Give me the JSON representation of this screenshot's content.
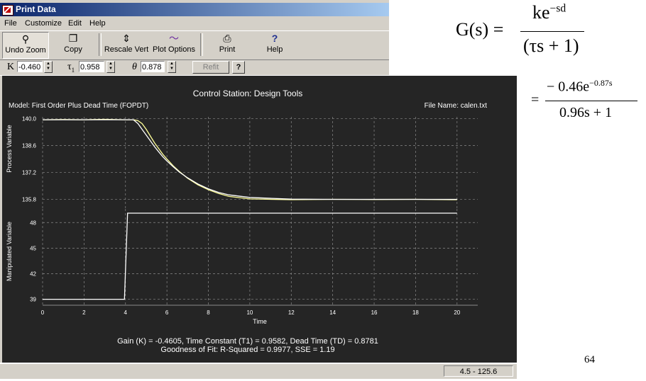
{
  "window": {
    "title": "Print Data"
  },
  "menu": [
    "File",
    "Customize",
    "Edit",
    "Help"
  ],
  "toolbar": {
    "undo_zoom": "Undo Zoom",
    "copy": "Copy",
    "rescale_vert": "Rescale Vert",
    "plot_options": "Plot Options",
    "print": "Print",
    "help": "Help"
  },
  "params": {
    "k_label": "K",
    "k_value": "-0.460",
    "tau_label": "τ",
    "tau_sub": "1",
    "tau_value": "0.958",
    "theta_label": "θ",
    "theta_value": "0.878",
    "refit_label": "Refit",
    "help_label": "?"
  },
  "plot": {
    "title": "Control Station: Design Tools",
    "model": "Model: First Order Plus Dead Time (FOPDT)",
    "file": "File Name: calen.txt",
    "pv_label": "Process Variable",
    "mv_label": "Manipulated Variable",
    "x_label": "Time",
    "fit_line1": "Gain (K) = -0.4605, Time Constant (T1) = 0.9582, Dead Time (TD) = 0.8781",
    "fit_line2": "Goodness of Fit: R-Squared = 0.9977, SSE = 1.19",
    "colors": {
      "background": "#252525",
      "grid": "#8a8a8a",
      "data": "#ffff99",
      "model": "#ffffff",
      "text": "#ffffff"
    }
  },
  "status": {
    "readout": "4.5 - 125.6"
  },
  "equations": {
    "lhs": "G(s) =",
    "num1_base": "ke",
    "num1_exp": "−sd",
    "den1": "(τs + 1)",
    "eq2": "=",
    "num2_base": "− 0.46e",
    "num2_exp": "−0.87s",
    "den2": "0.96s + 1"
  },
  "page_number": "64",
  "chart_data": [
    {
      "type": "line",
      "ylabel": "Process Variable",
      "xlabel": "",
      "xlim": [
        0,
        21
      ],
      "ylim": [
        135.3,
        140.1
      ],
      "yticks": [
        140.0,
        138.6,
        137.2,
        135.8
      ],
      "series": [
        {
          "x": [
            0,
            1,
            2,
            3,
            4,
            4.4,
            4.6,
            4.8,
            5.0,
            5.2,
            5.4,
            5.6,
            5.8,
            6.0,
            6.3,
            6.6,
            7.0,
            7.5,
            8.0,
            8.5,
            9,
            10,
            12,
            14,
            16,
            18,
            20
          ],
          "y": [
            139.95,
            139.96,
            139.95,
            139.97,
            139.95,
            139.95,
            139.9,
            139.75,
            139.45,
            139.1,
            138.75,
            138.45,
            138.15,
            137.9,
            137.55,
            137.25,
            136.9,
            136.55,
            136.3,
            136.1,
            135.95,
            135.82,
            135.78,
            135.8,
            135.79,
            135.8,
            135.78
          ]
        },
        {
          "x": [
            0,
            4.38,
            4.6,
            4.8,
            5.0,
            5.2,
            5.4,
            5.6,
            5.8,
            6.0,
            6.3,
            6.6,
            7.0,
            7.5,
            8.0,
            8.5,
            9,
            10,
            12,
            14,
            16,
            18,
            20
          ],
          "y": [
            139.95,
            139.95,
            139.75,
            139.45,
            139.15,
            138.85,
            138.55,
            138.28,
            138.02,
            137.8,
            137.5,
            137.22,
            136.92,
            136.6,
            136.35,
            136.16,
            136.03,
            135.9,
            135.81,
            135.8,
            135.8,
            135.8,
            135.8
          ]
        }
      ]
    },
    {
      "type": "line",
      "ylabel": "Manipulated Variable",
      "xlabel": "Time",
      "xlim": [
        0,
        21
      ],
      "ylim": [
        38.3,
        49.6
      ],
      "yticks": [
        39,
        42,
        45,
        48
      ],
      "xticks": [
        0,
        2,
        4,
        6,
        8,
        10,
        12,
        14,
        16,
        18,
        20
      ],
      "series": [
        {
          "x": [
            0,
            3.95,
            4.1,
            20.0
          ],
          "y": [
            39,
            39,
            49.1,
            49.1
          ]
        }
      ]
    }
  ]
}
